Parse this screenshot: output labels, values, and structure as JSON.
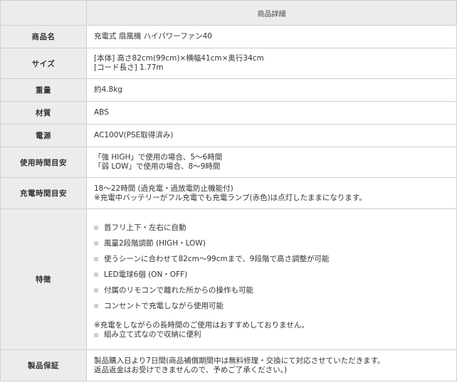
{
  "table": {
    "title": "商品詳細",
    "rows": [
      {
        "label": "商品名",
        "lines": [
          "充電式 扇風機 ハイパワーファン40"
        ]
      },
      {
        "label": "サイズ",
        "lines": [
          "[本体] 高さ82cm(99cm)×横幅41cm×奥行34cm",
          "[コード長さ] 1.77m"
        ]
      },
      {
        "label": "重量",
        "lines": [
          "約4.8kg"
        ]
      },
      {
        "label": "材質",
        "lines": [
          "ABS"
        ]
      },
      {
        "label": "電源",
        "lines": [
          "AC100V(PSE取得済み)"
        ]
      },
      {
        "label": "使用時間目安",
        "lines": [
          "「強 HIGH」で使用の場合、5～6時間",
          "「弱 LOW」で使用の場合、8～9時間"
        ]
      },
      {
        "label": "充電時間目安",
        "lines": [
          "18～22時間 (過充電・過放電防止機能付)",
          "※充電中バッテリーがフル充電でも充電ランプ(赤色)は点灯したままになります。"
        ]
      }
    ],
    "features": {
      "label": "特徴",
      "items": [
        "首フリ上下・左右に自動",
        "風量2段階調節 (HIGH・LOW)",
        "使うシーンに合わせて82cm～99cmまで、9段階で高さ調整が可能",
        "LED電球6個 (ON・OFF)",
        "付属のリモコンで離れた所からの操作も可能",
        "コンセントで充電しながら使用可能"
      ],
      "note": "※充電をしながらの長時間のご使用はおすすめしておりません。",
      "note_sub": "組み立て式なので収納に便利"
    },
    "warranty": {
      "label": "製品保証",
      "lines": [
        "製品購入日より7日間(商品補償期間中は無料修理・交換にて対応させていただきます。",
        "返品返金はお受けできませんので、予めご了承ください。)"
      ]
    }
  }
}
